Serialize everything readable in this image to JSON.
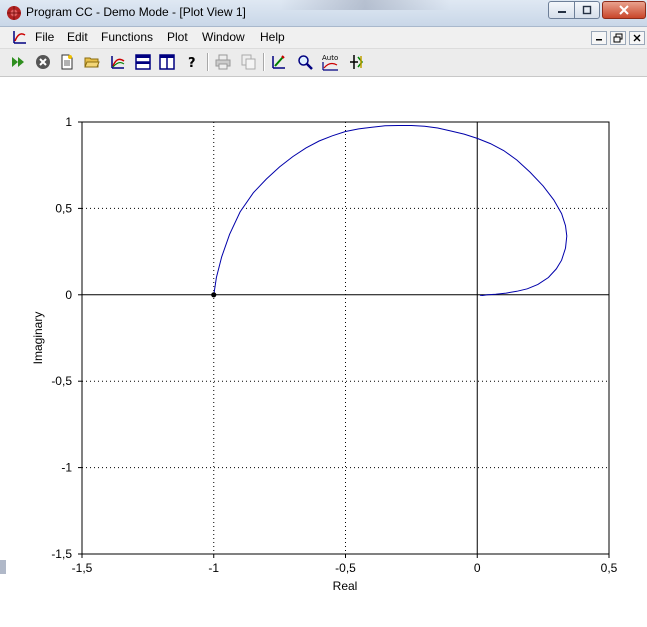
{
  "window": {
    "title": "Program CC - Demo Mode - [Plot View 1]"
  },
  "menu": {
    "items": [
      "File",
      "Edit",
      "Functions",
      "Plot",
      "Window",
      "Help"
    ]
  },
  "toolbar": {
    "auto_label": "Auto",
    "buttons": [
      "run-icon",
      "stop-icon",
      "new-document-icon",
      "open-folder-icon",
      "plot-icon",
      "tile-horizontal-icon",
      "tile-vertical-icon",
      "help-icon",
      "print-icon",
      "copy-icon",
      "edit-plot-icon",
      "zoom-icon",
      "auto-scale-icon",
      "cursor-icon"
    ]
  },
  "colors": {
    "curve": "#0000aa",
    "grid": "#000000",
    "title_bar": "#c9d7e8",
    "close_button": "#c9462a"
  },
  "chart_data": {
    "type": "line",
    "xlabel": "Real",
    "ylabel": "Imaginary",
    "xlim": [
      -1.5,
      0.5
    ],
    "ylim": [
      -1.5,
      1
    ],
    "xticks": [
      -1.5,
      -1,
      -0.5,
      0,
      0.5
    ],
    "xtick_labels": [
      "-1,5",
      "-1",
      "-0,5",
      "0",
      "0,5"
    ],
    "yticks": [
      -1.5,
      -1,
      -0.5,
      0,
      0.5,
      1
    ],
    "ytick_labels": [
      "-1,5",
      "-1",
      "-0,5",
      "0",
      "0,5",
      "1"
    ],
    "grid": "dotted",
    "series": [
      {
        "x": [
          -1.0,
          -0.99,
          -0.97,
          -0.94,
          -0.9,
          -0.85,
          -0.8,
          -0.75,
          -0.7,
          -0.65,
          -0.6,
          -0.55,
          -0.5,
          -0.45,
          -0.4,
          -0.35,
          -0.3,
          -0.25,
          -0.2,
          -0.15,
          -0.1,
          -0.05,
          0.0,
          0.05,
          0.1,
          0.15,
          0.2,
          0.25,
          0.29,
          0.32,
          0.335,
          0.34,
          0.335,
          0.32,
          0.3,
          0.27,
          0.23,
          0.19,
          0.15,
          0.11,
          0.07,
          0.04,
          0.02,
          0.01
        ],
        "y": [
          0.0,
          0.1,
          0.22,
          0.35,
          0.48,
          0.59,
          0.67,
          0.74,
          0.8,
          0.85,
          0.89,
          0.92,
          0.945,
          0.96,
          0.97,
          0.978,
          0.98,
          0.98,
          0.975,
          0.965,
          0.948,
          0.93,
          0.905,
          0.875,
          0.835,
          0.78,
          0.71,
          0.63,
          0.55,
          0.47,
          0.4,
          0.34,
          0.27,
          0.2,
          0.15,
          0.1,
          0.06,
          0.035,
          0.02,
          0.01,
          0.003,
          0.0,
          -0.004,
          -0.003
        ]
      }
    ],
    "marked_point": {
      "x": -1,
      "y": 0
    }
  }
}
